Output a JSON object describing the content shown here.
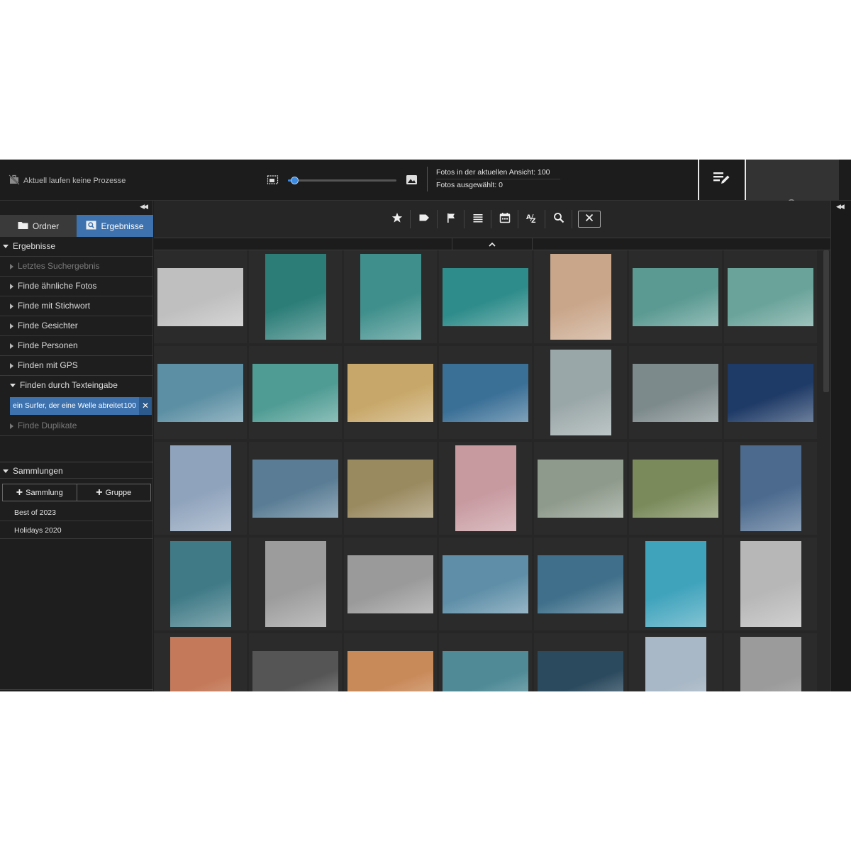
{
  "topbar": {
    "process_status": "Aktuell laufen keine Prozesse",
    "zoom_level_fraction": 0.06,
    "stats": {
      "photos_in_view": "Fotos in der aktuellen Ansicht: 100",
      "photos_selected": "Fotos ausgewählt: 0"
    },
    "right_tools": [
      {
        "icon": "copy-icon",
        "dim": false
      },
      {
        "icon": "location-pin-icon",
        "dim": false
      },
      {
        "icon": "key-icon",
        "dim": false
      },
      {
        "icon": "face-icon",
        "dim": false
      },
      {
        "icon": "people-icon",
        "dim": true
      },
      {
        "icon": "search-icon",
        "dim": true
      }
    ]
  },
  "sidebar": {
    "tabs": [
      {
        "label": "Ordner",
        "icon": "folder-icon",
        "active": false
      },
      {
        "label": "Ergebnisse",
        "icon": "search-results-icon",
        "active": true
      }
    ],
    "results_header": "Ergebnisse",
    "items": [
      {
        "label": "Letztes Suchergebnis",
        "dim": true,
        "expanded": false
      },
      {
        "label": "Finde ähnliche Fotos",
        "dim": false,
        "expanded": false
      },
      {
        "label": "Finde mit Stichwort",
        "dim": false,
        "expanded": false
      },
      {
        "label": "Finde Gesichter",
        "dim": false,
        "expanded": false
      },
      {
        "label": "Finde Personen",
        "dim": false,
        "expanded": false
      },
      {
        "label": "Finden mit GPS",
        "dim": false,
        "expanded": false
      },
      {
        "label": "Finden durch Texteingabe",
        "dim": false,
        "expanded": true
      }
    ],
    "search_term": {
      "text": "ein Surfer, der eine Welle abreitet",
      "count": "100"
    },
    "duplicates_label": "Finde Duplikate",
    "collections_header": "Sammlungen",
    "add_collection": "Sammlung",
    "add_group": "Gruppe",
    "collections": [
      "Best of 2023",
      "Holidays 2020"
    ]
  },
  "filterbar": {
    "icons": [
      "star-icon",
      "tag-icon",
      "flag-icon",
      "list-icon",
      "calendar-icon",
      "sort-az-icon",
      "search-icon"
    ],
    "close_icon": "close-icon"
  },
  "colors": {
    "accent": "#3d72ae",
    "background": "#1e1e1e",
    "cell": "#2b2b2b"
  },
  "thumbnails": [
    [
      "#bfbfbf",
      "#2c7d78",
      "#3f8f8c",
      "#2e8c8a",
      "#c9a68a",
      "#5b9a92",
      "#6aa39a"
    ],
    [
      "#5c8fa3",
      "#4f9c94",
      "#c8a86a",
      "#3a6f96",
      "#9aa7a8",
      "#7d8a8c",
      "#1e3a66"
    ],
    [
      "#8fa3bc",
      "#5a7d95",
      "#9a8a60",
      "#c79aa0",
      "#8e9a8c",
      "#7a8a5a",
      "#4b6a8e"
    ],
    [
      "#3f7a86",
      "#9c9c9c",
      "#9a9a9a",
      "#5f8fa8",
      "#3f6f8a",
      "#3fa3bc",
      "#b7b7b7"
    ],
    [
      "#c47a5a",
      "#555555",
      "#c98a5a",
      "#4f8a96",
      "#2c4a5e",
      "#a9b8c6",
      "#9b9b9b"
    ]
  ]
}
